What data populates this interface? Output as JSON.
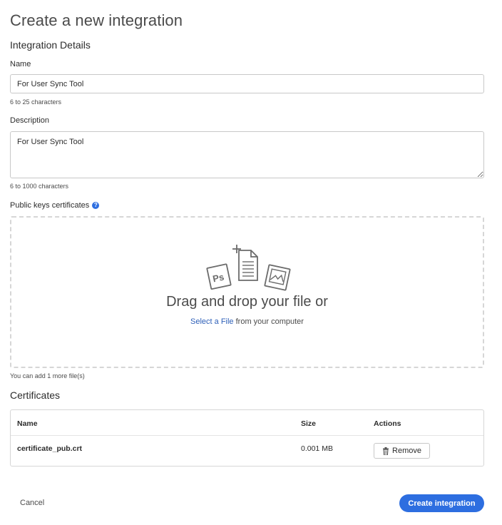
{
  "page": {
    "title": "Create a new integration"
  },
  "details": {
    "section_title": "Integration Details",
    "name": {
      "label": "Name",
      "value": "For User Sync Tool",
      "hint": "6 to 25 characters"
    },
    "description": {
      "label": "Description",
      "value": "For User Sync Tool",
      "hint": "6 to 1000 characters"
    }
  },
  "certificates_upload": {
    "label": "Public keys certificates",
    "help_icon": "question-circle-icon",
    "dropzone": {
      "illustration_icons": [
        "plus-icon",
        "document-icon",
        "photoshop-file-icon",
        "image-file-icon"
      ],
      "title": "Drag and drop your file or",
      "select_link": "Select a File",
      "select_suffix": " from your computer"
    },
    "files_hint": "You can add 1 more file(s)"
  },
  "certificates": {
    "title": "Certificates",
    "columns": {
      "name": "Name",
      "size": "Size",
      "actions": "Actions"
    },
    "rows": [
      {
        "name": "certificate_pub.crt",
        "size": "0.001 MB",
        "action": "Remove",
        "action_icon": "trash-icon"
      }
    ]
  },
  "footer": {
    "cancel": "Cancel",
    "create": "Create integration"
  },
  "colors": {
    "accent": "#2d6ee0",
    "link": "#2d5fb8",
    "border": "#c8c8c8",
    "dashed_border": "#d6d6d6"
  }
}
